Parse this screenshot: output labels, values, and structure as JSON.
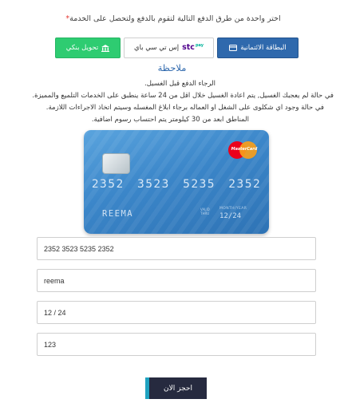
{
  "instruction": "اختر واحدة من طرق الدفع التالية لتقوم بالدفع ولتحصل على الخدمة",
  "required_mark": "*",
  "payment_methods": {
    "card": "البطاقة الائتمانية",
    "stc": "إس تي سي باي",
    "stc_logo": "stc",
    "stc_logo_small": "pay",
    "bank": "تحويل بنكي"
  },
  "note": {
    "title": "ملاحظة",
    "lines": [
      "الرجاء الدفع قبل الغسيل.",
      "في حالة لم يعجبك الغسيل, يتم اعادة الغسيل خلال اقل من 24 ساعة ينطبق على الخدمات التلميع والمميزة.",
      "في حالة وجود اي شكلوى على الشغل او العماله برجاء ابلاغ المغسله وسيتم اتخاذ الاجراءات اللازمة.",
      "المناطق ابعد من 30 كيلومتر يتم احتساب رسوم اضافية."
    ]
  },
  "card_preview": {
    "number": "2352 3523 5235 2352",
    "name": "REEMA",
    "expiry": "12/24",
    "expiry_label": "MONTH/YEAR",
    "valid_thru": "VALID THRU",
    "brand": "MasterCard"
  },
  "form": {
    "card_number": "2352 3523 5235 2352",
    "card_name": "reema",
    "expiry": "12 / 24",
    "cvv": "123"
  },
  "submit_label": "احجز الان",
  "colors": {
    "primary_blue": "#2f69ad",
    "green": "#2ecc71",
    "dark_button": "#262a3f",
    "accent_teal": "#1fa2c0",
    "required_red": "#e53935"
  },
  "icons": {
    "card_button": "credit-card-icon",
    "bank_button": "bank-icon"
  }
}
